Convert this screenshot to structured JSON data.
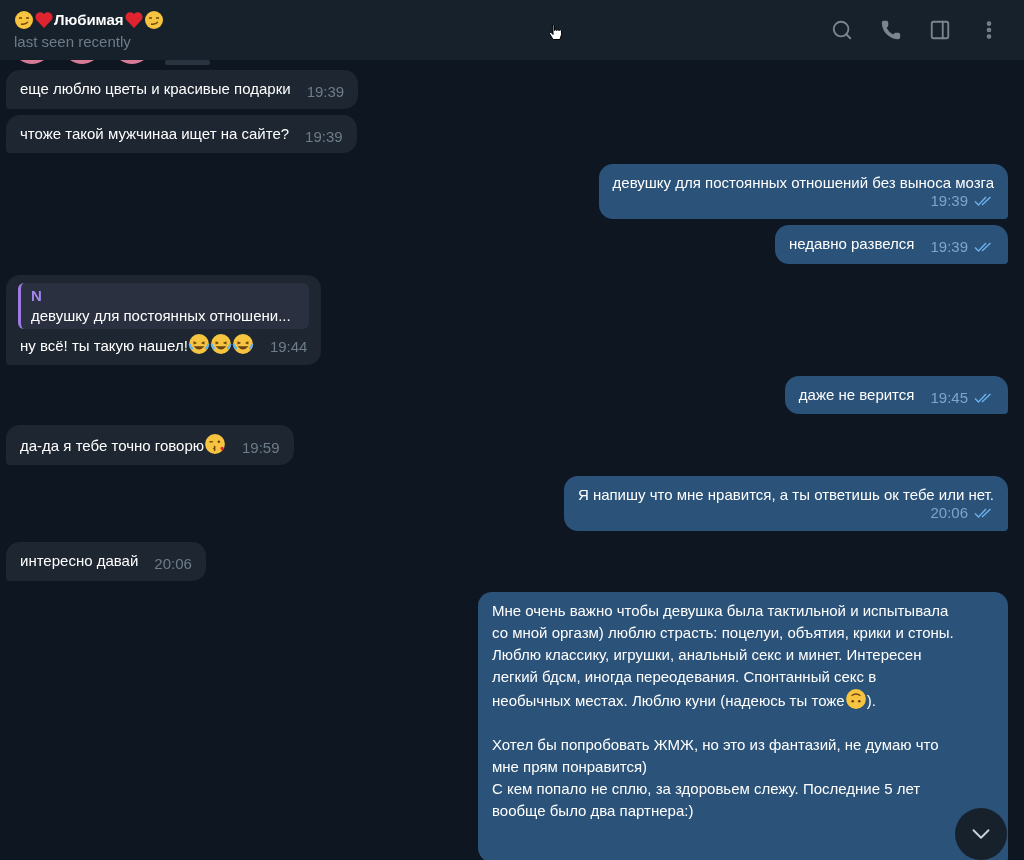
{
  "header": {
    "title": [
      {
        "kind": "smirk"
      },
      {
        "kind": "heart"
      },
      {
        "kind": "text",
        "text": "Любимая"
      },
      {
        "kind": "heart"
      },
      {
        "kind": "smirk"
      }
    ],
    "status": "last seen recently"
  },
  "messages": [
    {
      "kind": "cut-off"
    },
    {
      "kind": "incoming",
      "parts": [
        {
          "kind": "text",
          "text": "еще люблю цветы и красивые подарки"
        }
      ],
      "time": "19:39"
    },
    {
      "kind": "incoming",
      "parts": [
        {
          "kind": "text",
          "text": "чтоже такой мужчинаа ищет на сайте?"
        }
      ],
      "time": "19:39"
    },
    {
      "kind": "outgoing",
      "parts": [
        {
          "kind": "text",
          "text": "девушку для постоянных отношений без выноса мозга"
        }
      ],
      "time": "19:39",
      "read": true
    },
    {
      "kind": "outgoing",
      "parts": [
        {
          "kind": "text",
          "text": "недавно развелся"
        }
      ],
      "time": "19:39",
      "read": true
    },
    {
      "kind": "incoming",
      "reply": {
        "author": "N",
        "text": "девушку для постоянных отношени..."
      },
      "parts": [
        {
          "kind": "text",
          "text": "ну всё! ты такую нашел!"
        },
        {
          "kind": "laugh"
        },
        {
          "kind": "laugh"
        },
        {
          "kind": "laugh"
        }
      ],
      "time": "19:44"
    },
    {
      "kind": "outgoing",
      "parts": [
        {
          "kind": "text",
          "text": "даже не верится"
        }
      ],
      "time": "19:45",
      "read": true
    },
    {
      "kind": "incoming",
      "parts": [
        {
          "kind": "text",
          "text": "да-да я тебе точно говорю"
        },
        {
          "kind": "kiss"
        }
      ],
      "time": "19:59"
    },
    {
      "kind": "outgoing",
      "parts": [
        {
          "kind": "text",
          "text": "Я напишу что мне нравится, а ты ответишь ок тебе или нет."
        }
      ],
      "time": "20:06",
      "read": true
    },
    {
      "kind": "incoming",
      "parts": [
        {
          "kind": "text",
          "text": "интересно давай"
        }
      ],
      "time": "20:06"
    },
    {
      "kind": "outgoing",
      "parts": [
        {
          "kind": "text",
          "text": "Мне очень важно чтобы девушка была тактильной и испытывала со мной оргазм) люблю страсть: поцелуи, объятия, крики и стоны. Люблю классику, игрушки, анальный секс и минет. Интересен легкий бдсм, иногда переодевания. Спонтанный секс в необычных местах. Люблю куни (надеюсь ты тоже"
        },
        {
          "kind": "upside"
        },
        {
          "kind": "text",
          "text": ").\n\nХотел бы попробовать ЖМЖ, но это из фантазий, не думаю что мне прям понравится)\nС кем попало не сплю, за здоровьем слежу. Последние 5 лет вообще было два партнера:)"
        }
      ]
    }
  ]
}
